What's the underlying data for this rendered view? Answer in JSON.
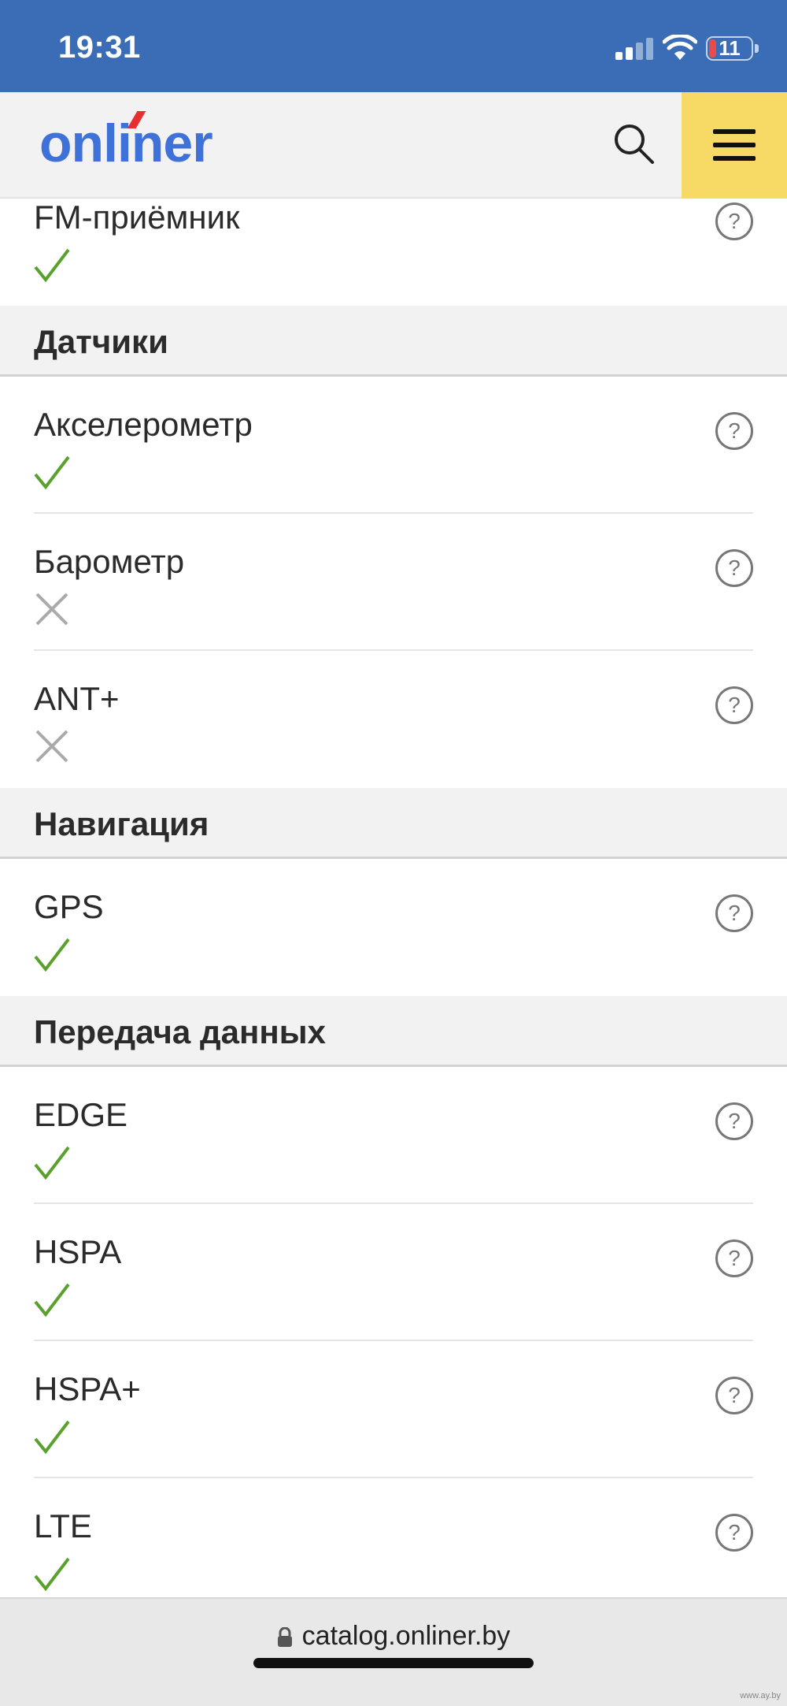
{
  "status": {
    "time": "19:31",
    "battery": "11"
  },
  "header": {
    "logo": "onliner"
  },
  "colors": {
    "status_bar": "#3a6db5",
    "logo": "#3f72d9",
    "menu_button": "#f7d965",
    "check": "#5aa02c",
    "cross": "#aaaaaa"
  },
  "icons": {
    "search": "search-icon",
    "menu": "menu-icon",
    "help": "help-icon",
    "check": "check-icon",
    "cross": "cross-icon",
    "lock": "lock-icon"
  },
  "spec": {
    "top_row": {
      "label": "FM-приёмник",
      "value": "yes",
      "help": "?"
    },
    "sections": [
      {
        "title": "Датчики",
        "rows": [
          {
            "label": "Акселерометр",
            "value": "yes",
            "help": "?"
          },
          {
            "label": "Барометр",
            "value": "no",
            "help": "?"
          },
          {
            "label": "ANT+",
            "value": "no",
            "help": "?"
          }
        ]
      },
      {
        "title": "Навигация",
        "rows": [
          {
            "label": "GPS",
            "value": "yes",
            "help": "?"
          }
        ]
      },
      {
        "title": "Передача данных",
        "rows": [
          {
            "label": "EDGE",
            "value": "yes",
            "help": "?"
          },
          {
            "label": "HSPA",
            "value": "yes",
            "help": "?"
          },
          {
            "label": "HSPA+",
            "value": "yes",
            "help": "?"
          },
          {
            "label": "LTE",
            "value": "yes",
            "help": "?"
          }
        ]
      }
    ]
  },
  "browser": {
    "url": "catalog.onliner.by"
  },
  "watermark": "www.ay.by"
}
